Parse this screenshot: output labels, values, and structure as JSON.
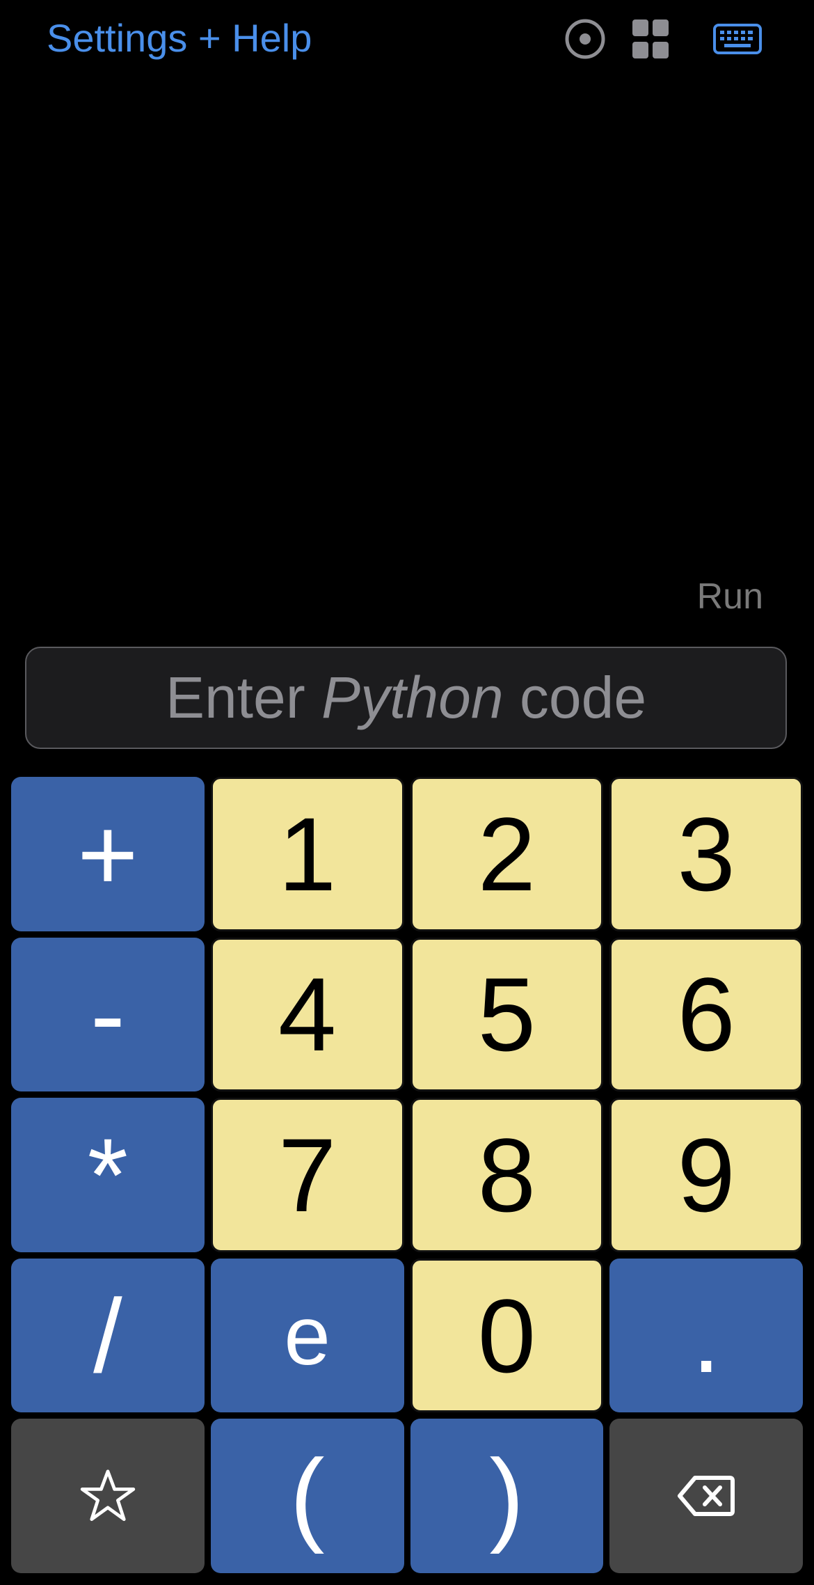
{
  "header": {
    "settings_label": "Settings + Help",
    "icons": [
      "record-icon",
      "grid-icon",
      "keyboard-icon"
    ]
  },
  "run_label": "Run",
  "input": {
    "placeholder_prefix": "Enter ",
    "placeholder_emphasis": "Python",
    "placeholder_suffix": " code"
  },
  "keypad": {
    "plus": "+",
    "one": "1",
    "two": "2",
    "three": "3",
    "minus": "-",
    "four": "4",
    "five": "5",
    "six": "6",
    "multiply": "*",
    "seven": "7",
    "eight": "8",
    "nine": "9",
    "divide": "/",
    "e": "e",
    "zero": "0",
    "dot": ".",
    "favorites_icon": "star-icon",
    "open_paren": "(",
    "close_paren": ")",
    "backspace_icon": "backspace-icon"
  },
  "colors": {
    "link": "#4A8FEA",
    "digit_key": "#F2E59B",
    "operator_key": "#3A62A7",
    "utility_key": "#464646",
    "input_background": "#1C1C1E",
    "run_text": "#7A7A7A",
    "background": "#000000"
  }
}
